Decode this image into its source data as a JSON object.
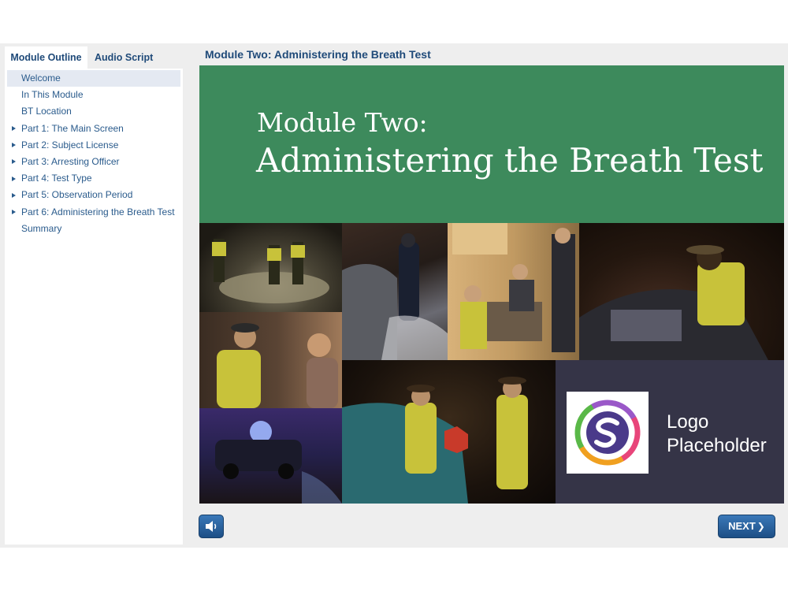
{
  "sidebar": {
    "tabs": [
      {
        "label": "Module Outline",
        "active": true
      },
      {
        "label": "Audio Script",
        "active": false
      }
    ],
    "items": [
      {
        "label": "Welcome",
        "selected": true,
        "expandable": false
      },
      {
        "label": "In This Module",
        "expandable": false
      },
      {
        "label": "BT Location",
        "expandable": false
      },
      {
        "label": "Part 1: The Main Screen",
        "expandable": true
      },
      {
        "label": "Part 2: Subject License",
        "expandable": true
      },
      {
        "label": "Part 3: Arresting Officer",
        "expandable": true
      },
      {
        "label": "Part 4: Test Type",
        "expandable": true
      },
      {
        "label": "Part 5: Observation Period",
        "expandable": true
      },
      {
        "label": "Part 6: Administering the Breath Test",
        "expandable": true
      },
      {
        "label": "Summary",
        "expandable": false
      }
    ]
  },
  "main": {
    "slide_title": "Module Two: Administering the Breath Test",
    "banner": {
      "line1": "Module Two:",
      "line2": "Administering the Breath Test"
    },
    "logo": {
      "line1": "Logo",
      "line2": "Placeholder"
    }
  },
  "controls": {
    "audio_icon": "speaker-icon",
    "next_label": "NEXT"
  },
  "colors": {
    "banner_green": "#3d8a5c",
    "link_blue": "#2a5b8c",
    "button_blue": "#2a64a0",
    "logo_panel": "#353447"
  }
}
